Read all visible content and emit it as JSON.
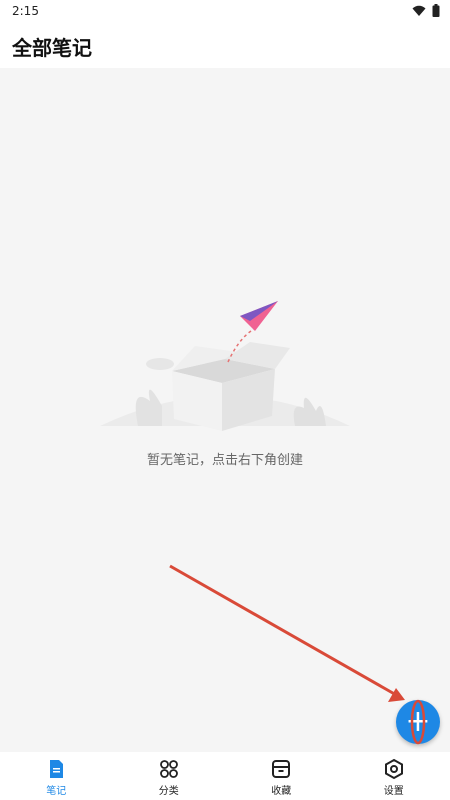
{
  "status_bar": {
    "time": "2:15",
    "icons": [
      "wifi-icon",
      "battery-icon"
    ]
  },
  "header": {
    "title": "全部笔记"
  },
  "empty_state": {
    "message": "暂无笔记，点击右下角创建",
    "illustration": "empty-box-paper-plane"
  },
  "fab": {
    "icon": "plus-icon",
    "color": "#1e88e5"
  },
  "bottom_nav": {
    "items": [
      {
        "label": "笔记",
        "icon": "note-icon",
        "active": true
      },
      {
        "label": "分类",
        "icon": "grid-circles-icon",
        "active": false
      },
      {
        "label": "收藏",
        "icon": "archive-box-icon",
        "active": false
      },
      {
        "label": "设置",
        "icon": "hex-settings-icon",
        "active": false
      }
    ],
    "active_color": "#1e88e5"
  },
  "annotation": {
    "color": "#d94a38"
  }
}
